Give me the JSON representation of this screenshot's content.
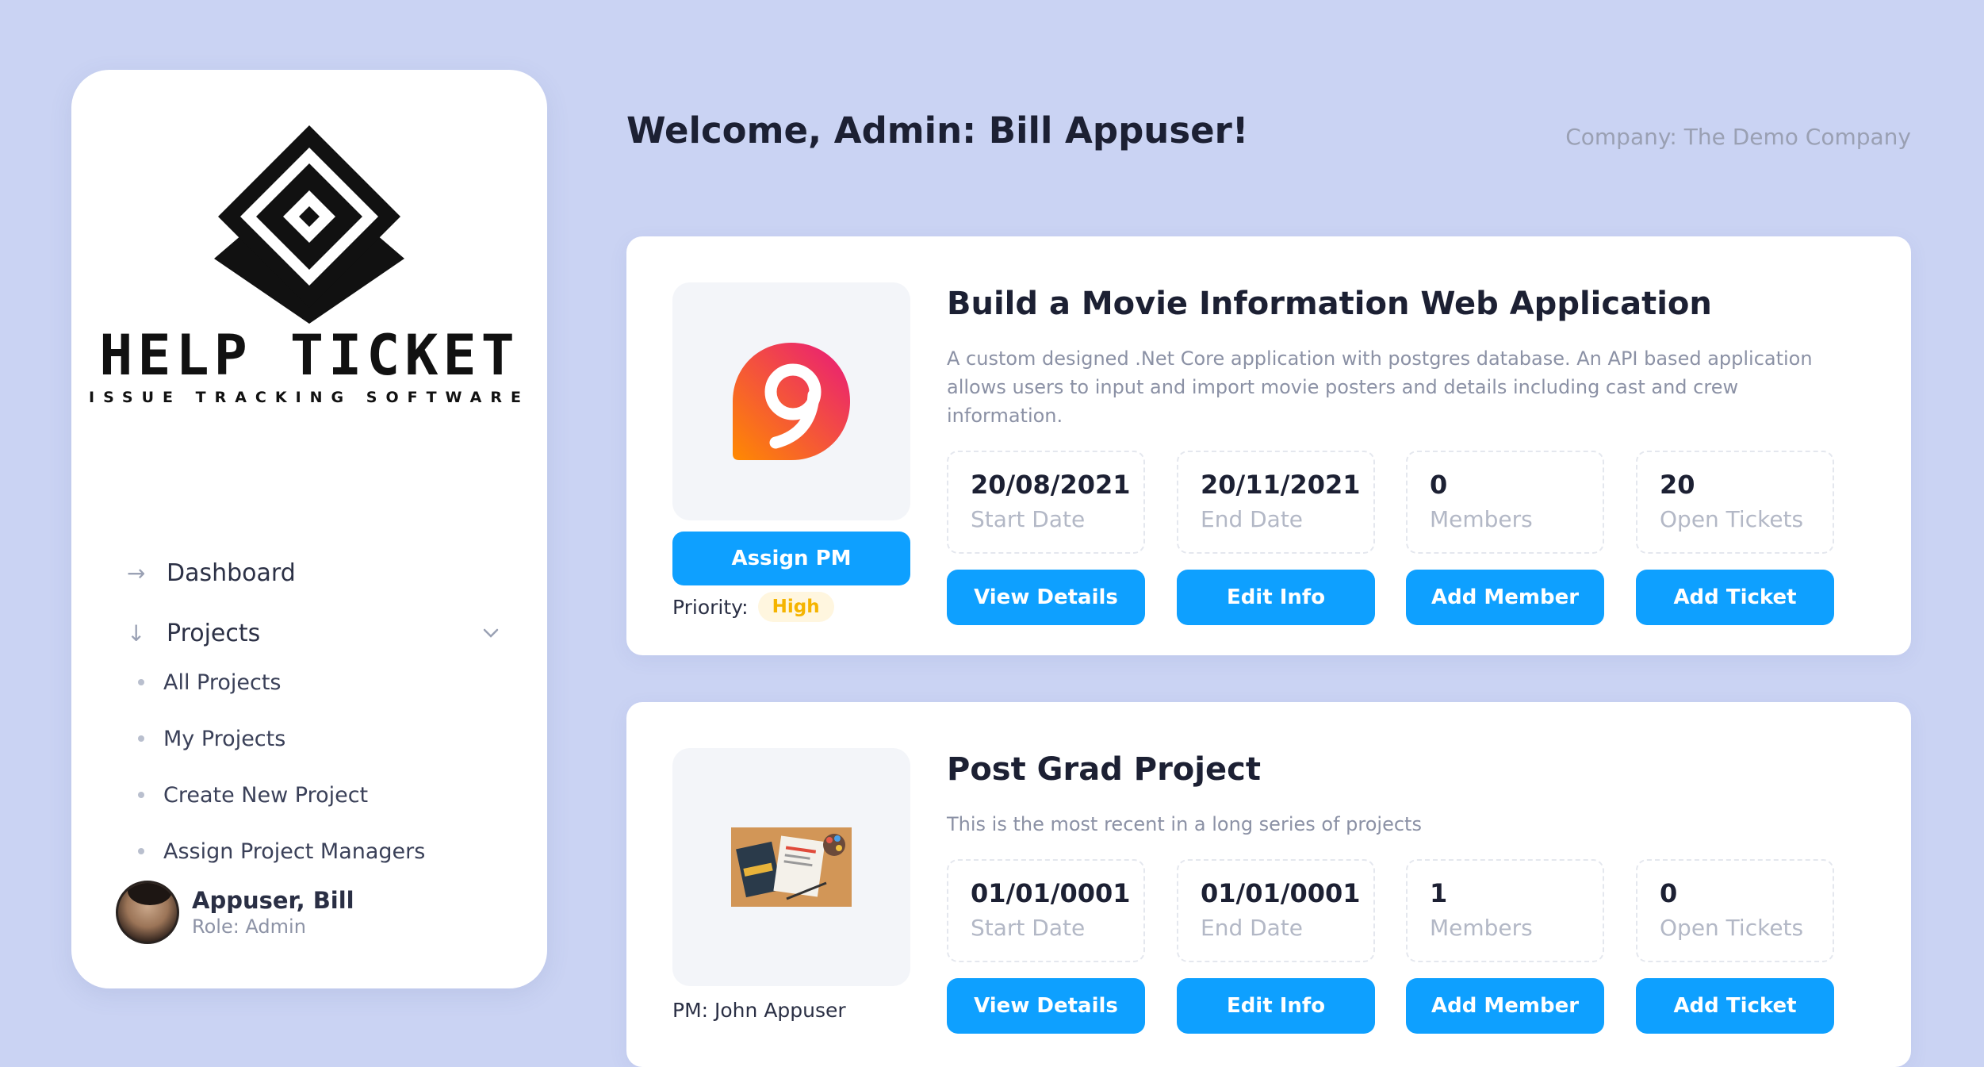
{
  "sidebar": {
    "brand": {
      "name": "HELP TICKET",
      "tagline": "ISSUE TRACKING SOFTWARE"
    },
    "nav": [
      {
        "label": "Dashboard",
        "icon": "arrow-right-icon"
      },
      {
        "label": "Projects",
        "icon": "arrow-down-icon",
        "expanded": true
      }
    ],
    "project_links": [
      "All Projects",
      "My Projects",
      "Create New Project",
      "Assign Project Managers"
    ],
    "user": {
      "name": "Appuser, Bill",
      "role": "Role: Admin"
    }
  },
  "header": {
    "welcome": "Welcome, Admin: Bill Appuser!",
    "company": "Company: The Demo Company"
  },
  "projects": [
    {
      "title": "Build a Movie Information Web Application",
      "description": "A custom designed .Net Core application with postgres database. An API based application allows users to input and import movie posters and details including cast and crew information.",
      "assign_pm_label": "Assign PM",
      "priority_label": "Priority:",
      "priority": "High",
      "stats": [
        {
          "value": "20/08/2021",
          "label": "Start Date"
        },
        {
          "value": "20/11/2021",
          "label": "End Date"
        },
        {
          "value": "0",
          "label": "Members"
        },
        {
          "value": "20",
          "label": "Open Tickets"
        }
      ],
      "actions": [
        "View Details",
        "Edit Info",
        "Add Member",
        "Add Ticket"
      ]
    },
    {
      "title": "Post Grad Project",
      "description": "This is the most recent in a long series of projects",
      "pm": "PM: John Appuser",
      "stats": [
        {
          "value": "01/01/0001",
          "label": "Start Date"
        },
        {
          "value": "01/01/0001",
          "label": "End Date"
        },
        {
          "value": "1",
          "label": "Members"
        },
        {
          "value": "0",
          "label": "Open Tickets"
        }
      ],
      "actions": [
        "View Details",
        "Edit Info",
        "Add Member",
        "Add Ticket"
      ]
    }
  ],
  "colors": {
    "background": "#cad3f3",
    "accent": "#0ea0ff",
    "priority_high": "#f5b400"
  }
}
